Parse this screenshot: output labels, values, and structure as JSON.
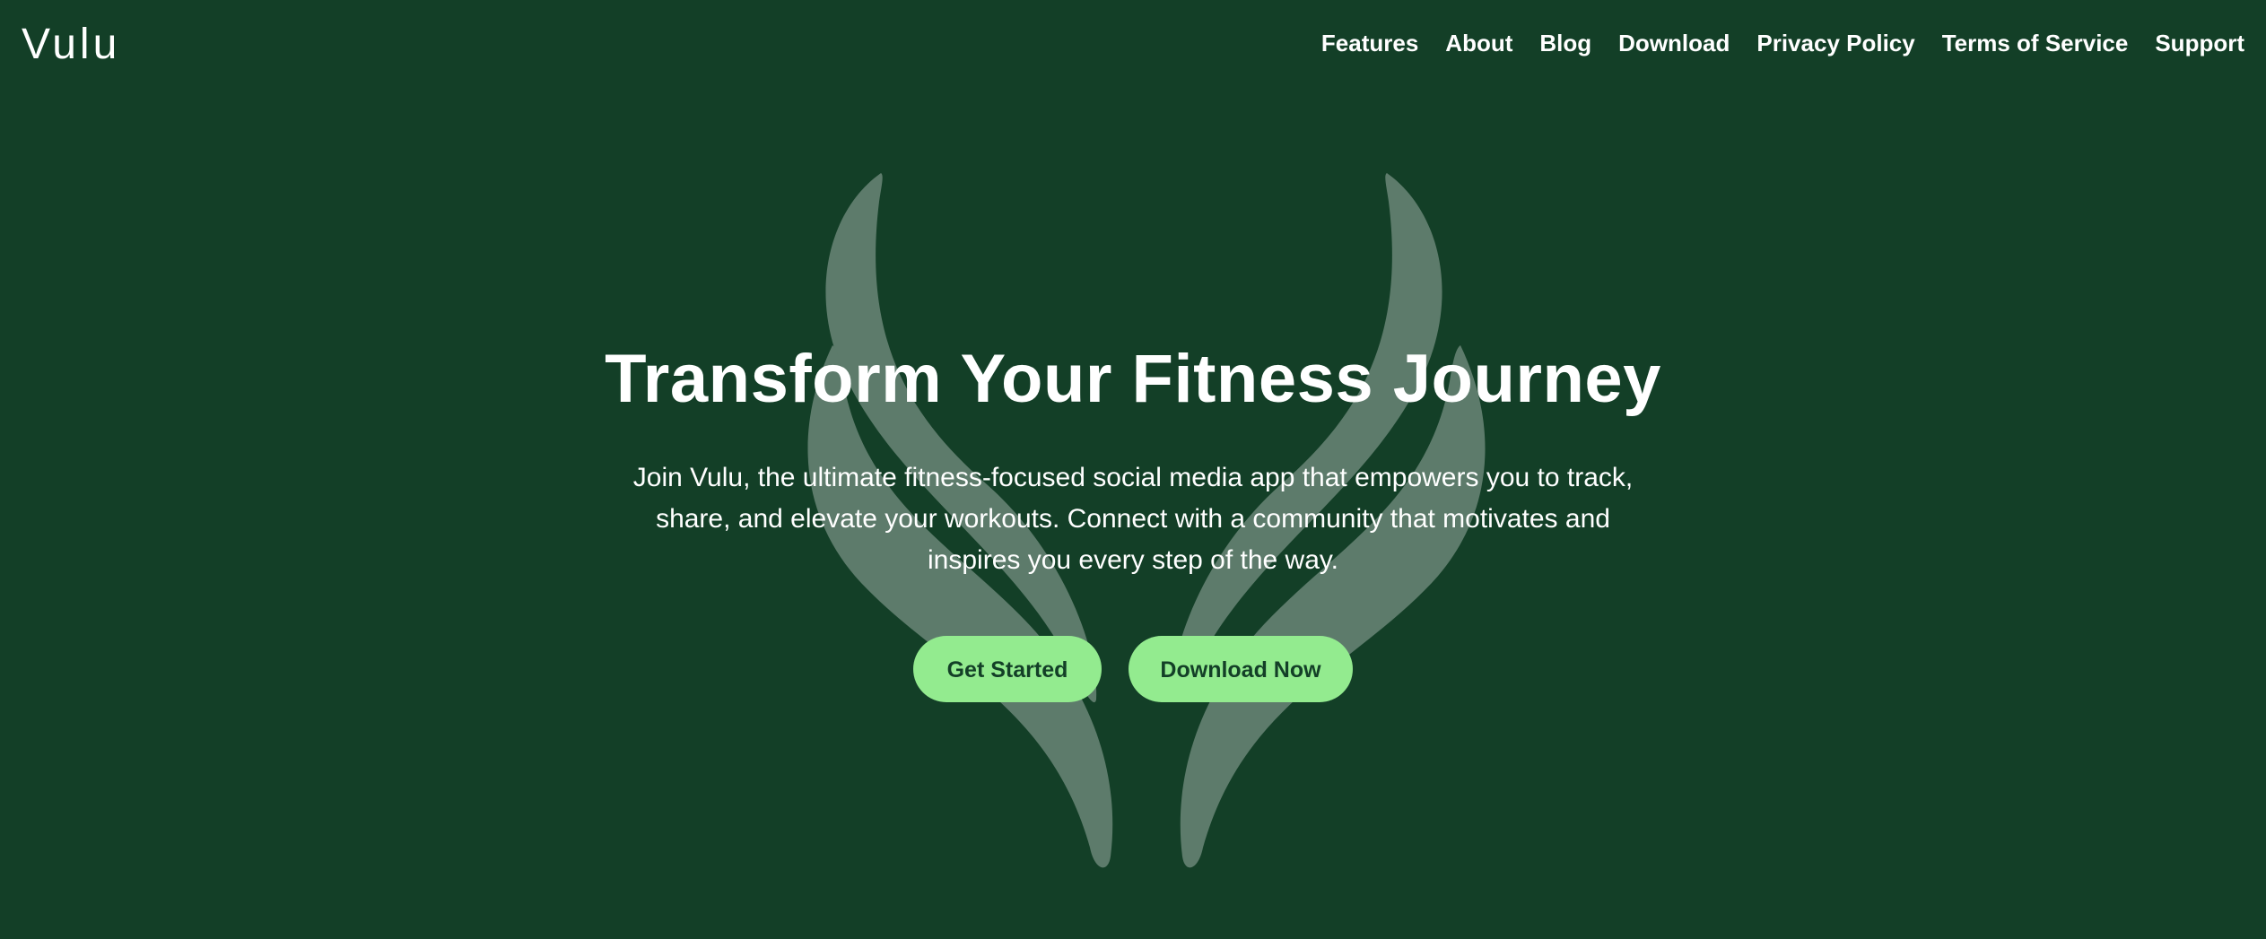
{
  "header": {
    "brand": "Vulu",
    "nav": [
      {
        "label": "Features"
      },
      {
        "label": "About"
      },
      {
        "label": "Blog"
      },
      {
        "label": "Download"
      },
      {
        "label": "Privacy Policy"
      },
      {
        "label": "Terms of Service"
      },
      {
        "label": "Support"
      }
    ]
  },
  "hero": {
    "title": "Transform Your Fitness Journey",
    "description": "Join Vulu, the ultimate fitness-focused social media app that empowers you to track, share, and elevate your workouts. Connect with a community that motivates and inspires you every step of the way.",
    "primary_cta": "Get Started",
    "secondary_cta": "Download Now"
  },
  "colors": {
    "background": "#133f27",
    "accent": "#93eb8f",
    "emblem": "#5d7b6b",
    "text": "#ffffff"
  },
  "icons": {
    "emblem": "leaf-emblem-icon"
  }
}
